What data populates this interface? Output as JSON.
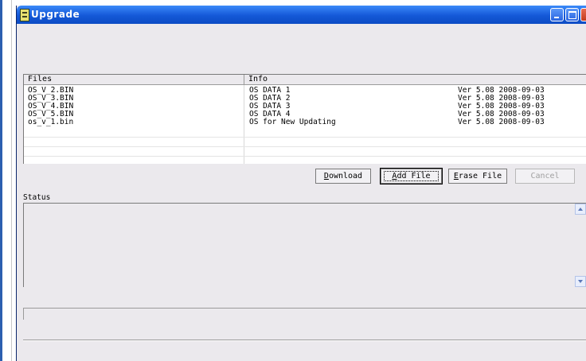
{
  "window": {
    "title": "Upgrade",
    "colors": {
      "titlebar": "#1458d8",
      "body": "#ebe9ed",
      "close": "#c23a1c"
    }
  },
  "file_list": {
    "columns": [
      "Files",
      "Info"
    ],
    "rows": [
      {
        "file": "OS_V_2.BIN",
        "info": "OS DATA 1",
        "version": "Ver 5.08 2008-09-03"
      },
      {
        "file": "OS_V_3.BIN",
        "info": "OS DATA 2",
        "version": "Ver 5.08 2008-09-03"
      },
      {
        "file": "OS_V_4.BIN",
        "info": "OS DATA 3",
        "version": "Ver 5.08 2008-09-03"
      },
      {
        "file": "OS_V_5.BIN",
        "info": "OS DATA 4",
        "version": "Ver 5.08 2008-09-03"
      },
      {
        "file": "os_v_1.bin",
        "info": "OS for New Updating",
        "version": "Ver 5.08 2008-09-03"
      }
    ]
  },
  "buttons": {
    "download": {
      "mnemonic": "D",
      "rest": "ownload"
    },
    "add_file": {
      "mnemonic": "A",
      "rest": "dd File"
    },
    "erase_file": {
      "mnemonic": "E",
      "rest": "rase File"
    },
    "cancel": "Cancel"
  },
  "status": {
    "label": "Status"
  }
}
